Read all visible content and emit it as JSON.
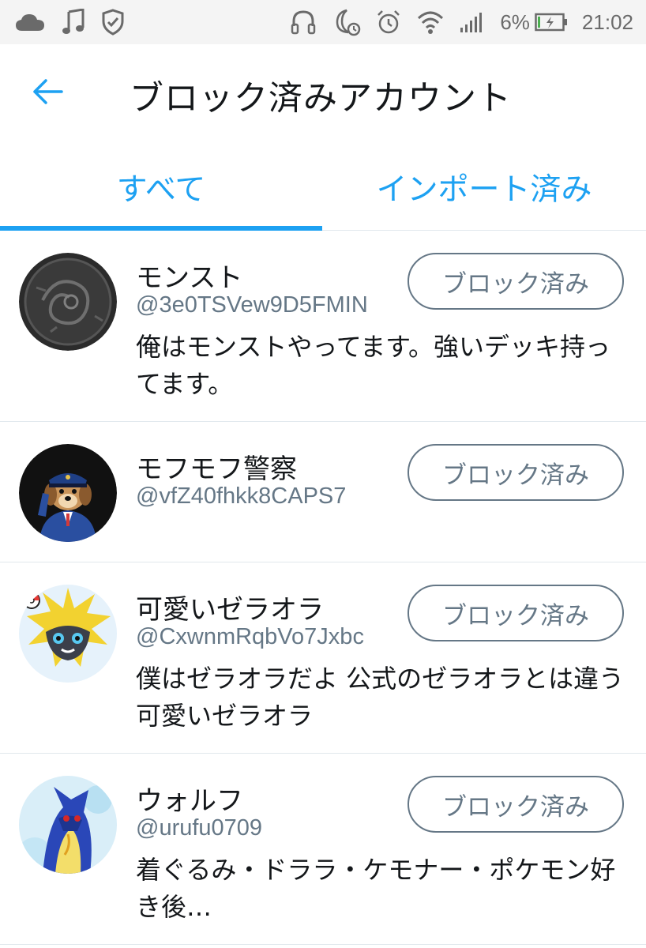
{
  "status_bar": {
    "left_icons": [
      "cloud-icon",
      "music-note-icon",
      "shield-check-icon"
    ],
    "right_icons": [
      "headphones-icon",
      "moon-alarm-icon",
      "alarm-clock-icon",
      "wifi-icon",
      "signal-icon",
      "battery-charging-icon"
    ],
    "battery_percent": "6%",
    "time": "21:02"
  },
  "app_bar": {
    "back_icon": "arrow-left-icon",
    "title": "ブロック済みアカウント"
  },
  "tabs": {
    "all_label": "すべて",
    "imported_label": "インポート済み",
    "active": "all"
  },
  "accounts": [
    {
      "name": "モンスト",
      "handle": "@3e0TSVew9D5FMIN",
      "bio": "俺はモンストやってます。強いデッキ持ってます。",
      "button_label": "ブロック済み"
    },
    {
      "name": "モフモフ警察",
      "handle": "@vfZ40fhkk8CAPS7",
      "bio": "",
      "button_label": "ブロック済み"
    },
    {
      "name": "可愛いゼラオラ",
      "handle": "@CxwnmRqbVo7Jxbc",
      "bio": "僕はゼラオラだよ 公式のゼラオラとは違う可愛いゼラオラ",
      "button_label": "ブロック済み"
    },
    {
      "name": "ウォルフ",
      "handle": "@urufu0709",
      "bio": "着ぐるみ・ドララ・ケモナー・ポケモン好き後…",
      "button_label": "ブロック済み"
    }
  ],
  "colors": {
    "accent": "#1da1f2",
    "secondary_text": "#657786",
    "divider": "#e1e8ed",
    "status_bar_bg": "#f4f4f4"
  }
}
